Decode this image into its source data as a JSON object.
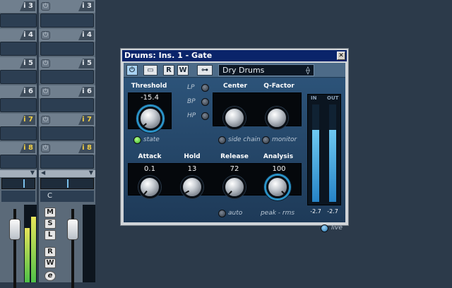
{
  "mixer": {
    "strip1": {
      "slots": [
        {
          "label": "i 3",
          "active": false
        },
        {
          "label": "i 4",
          "active": false
        },
        {
          "label": "i 5",
          "active": false
        },
        {
          "label": "i 6",
          "active": false
        },
        {
          "label": "i 7",
          "active": true
        },
        {
          "label": "i 8",
          "active": true
        }
      ]
    },
    "strip2": {
      "slots": [
        {
          "label": "i 3",
          "active": false
        },
        {
          "label": "i 4",
          "active": false
        },
        {
          "label": "i 5",
          "active": false
        },
        {
          "label": "i 6",
          "active": false
        },
        {
          "label": "i 7",
          "active": true
        },
        {
          "label": "i 8",
          "active": true
        }
      ],
      "pan_value": "C",
      "buttons": {
        "mute": "M",
        "solo": "S",
        "listen": "L",
        "read": "R",
        "write": "W",
        "edit": "e"
      }
    }
  },
  "plugin": {
    "title": "Drums: Ins. 1 - Gate",
    "close": "✕",
    "toolbar": {
      "read": "R",
      "write": "W",
      "preset": "Dry Drums"
    },
    "threshold": {
      "label": "Threshold",
      "value": "-15.4"
    },
    "filter_labels": {
      "lp": "LP",
      "bp": "BP",
      "hp": "HP"
    },
    "state_label": "state",
    "center_label": "Center",
    "qfactor_label": "Q-Factor",
    "side_chain_label": "side chain",
    "monitor_label": "monitor",
    "attack": {
      "label": "Attack",
      "value": "0.1"
    },
    "hold": {
      "label": "Hold",
      "value": "13"
    },
    "release": {
      "label": "Release",
      "value": "72"
    },
    "analysis": {
      "label": "Analysis",
      "value": "100"
    },
    "auto_label": "auto",
    "peak_rms_label": "peak - rms",
    "meters": {
      "in_label": "IN",
      "out_label": "OUT",
      "in_value": "-2.7",
      "out_value": "-2.7"
    },
    "live_label": "live"
  },
  "colors": {
    "accent": "#2a93c8",
    "state_led": "#3fcf2e",
    "active_slot": "#f2cf45"
  }
}
